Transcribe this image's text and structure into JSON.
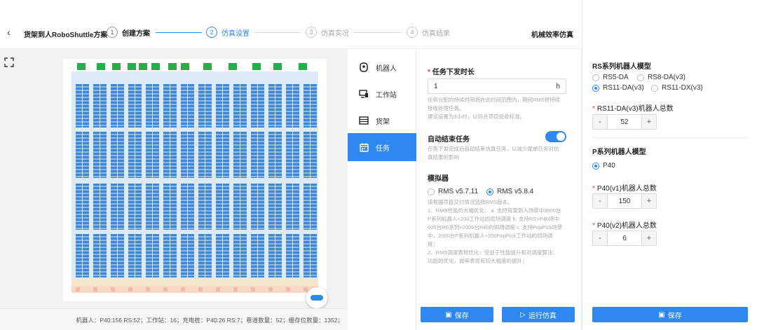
{
  "header": {
    "back_icon": "chevron-left-icon",
    "scheme_title": "货架到人RoboShuttle方案",
    "steps": [
      {
        "num": "1",
        "label": "创建方案"
      },
      {
        "num": "2",
        "label": "仿真设置"
      },
      {
        "num": "3",
        "label": "仿真实况"
      },
      {
        "num": "4",
        "label": "仿真结果"
      }
    ],
    "right_title": "机械效率仿真"
  },
  "map": {
    "expand_icon": "expand-icon",
    "status": "机器人：P40:156 RS:52；工作站：16；充电桩：P40:26 RS:7；巷道数量：52；缓存位数量：1352；"
  },
  "nav": {
    "items": [
      {
        "label": "机器人",
        "icon": "robot-icon"
      },
      {
        "label": "工作站",
        "icon": "workstation-icon"
      },
      {
        "label": "货架",
        "icon": "shelf-icon"
      },
      {
        "label": "任务",
        "icon": "calendar-icon"
      }
    ]
  },
  "form": {
    "duration_label": "任务下发时长",
    "duration_value": "1",
    "duration_unit": "h",
    "duration_hint1": "任务分配的持续时间将在此时间范围内，期间RMS将持续",
    "duration_hint2": "接收处理任务。",
    "duration_hint3": "建议设置为3小时，以符合项目验收标准。",
    "auto_end_label": "自动结束任务",
    "auto_end_hint1": "任务下发完成后自动结束仿真任务，以减少尾单任务对仿",
    "auto_end_hint2": "真结果的影响",
    "simulator_label": "模拟器",
    "rms_option_1": "RMS v5.7.11",
    "rms_option_2": "RMS v5.8.4",
    "rms_notes": [
      "请根据项目交付情况选择RMS版本。",
      "1、RMS性能的大幅优化： a. 支持货架到人场景中3600台",
      "P系列机器人+200工作站的同场调度 b. 支持RS+P40场中",
      "600台RS系列+2000台P40的同场调度 c. 支持PopPick场景",
      "中，2000台P系列机器人+200PopPick工作站的同场调",
      "度；",
      "2、RMS调度表现优化：受益于性能提升和对调度算法、",
      "功能的优化，效率表现有较大幅度的提升；"
    ],
    "save_label": "保存",
    "run_label": "运行仿真"
  },
  "right": {
    "rs_model_label": "RS系列机器人模型",
    "rs_options": [
      "RS5-DA",
      "RS8-DA(v3)",
      "RS11-DA(v3)",
      "RS11-DX(v3)"
    ],
    "rs_total_label": "RS11-DA(v3)机器人总数",
    "rs_total_value": "52",
    "p_model_label": "P系列机器人模型",
    "p_option": "P40",
    "p40v1_label": "P40(v1)机器人总数",
    "p40v1_value": "150",
    "p40v2_label": "P40(v2)机器人总数",
    "p40v2_value": "6",
    "minus": "-",
    "plus": "+",
    "save_label": "保存"
  },
  "colors": {
    "accent": "#2f88f0",
    "station_green": "#23b04a",
    "rack_blue": "#3f86d3"
  }
}
